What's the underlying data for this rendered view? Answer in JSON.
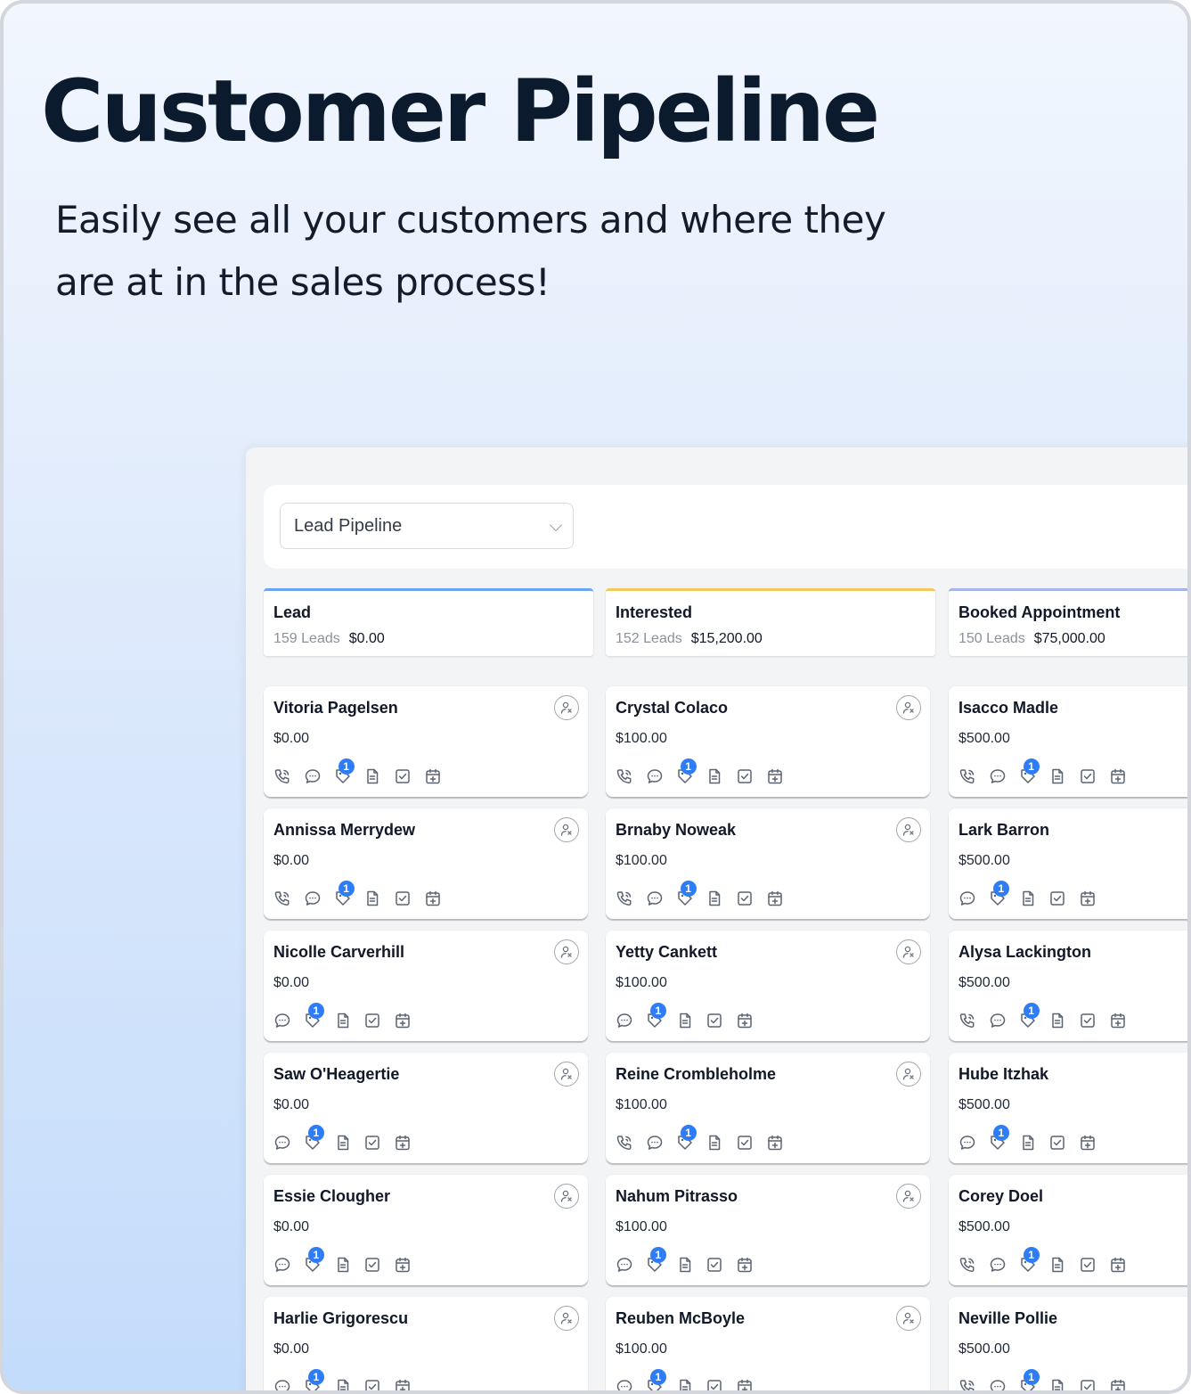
{
  "hero": {
    "title": "Customer Pipeline",
    "subtitle": "Easily see all your customers and where they are at in the sales process!"
  },
  "pipeline_select": {
    "value": "Lead Pipeline"
  },
  "colors": {
    "accent": "#2f7df6",
    "lead": "#6aa5ef",
    "interested": "#f4c85a",
    "booked": "#a9b4e6"
  },
  "stages": [
    {
      "name": "Lead",
      "count": "159 Leads",
      "amount": "$0.00",
      "cards": [
        {
          "name": "Vitoria Pagelsen",
          "value": "$0.00",
          "icons": [
            "phone",
            "chat",
            "tag",
            "doc",
            "check",
            "calendar"
          ],
          "badge": "1"
        },
        {
          "name": "Annissa Merrydew",
          "value": "$0.00",
          "icons": [
            "phone",
            "chat",
            "tag",
            "doc",
            "check",
            "calendar"
          ],
          "badge": "1"
        },
        {
          "name": "Nicolle Carverhill",
          "value": "$0.00",
          "icons": [
            "chat",
            "tag",
            "doc",
            "check",
            "calendar"
          ],
          "badge": "1"
        },
        {
          "name": "Saw O'Heagertie",
          "value": "$0.00",
          "icons": [
            "chat",
            "tag",
            "doc",
            "check",
            "calendar"
          ],
          "badge": "1"
        },
        {
          "name": "Essie Clougher",
          "value": "$0.00",
          "icons": [
            "chat",
            "tag",
            "doc",
            "check",
            "calendar"
          ],
          "badge": "1"
        },
        {
          "name": "Harlie Grigorescu",
          "value": "$0.00",
          "icons": [
            "chat",
            "tag",
            "doc",
            "check",
            "calendar"
          ],
          "badge": "1"
        }
      ]
    },
    {
      "name": "Interested",
      "count": "152 Leads",
      "amount": "$15,200.00",
      "cards": [
        {
          "name": "Crystal Colaco",
          "value": "$100.00",
          "icons": [
            "phone",
            "chat",
            "tag",
            "doc",
            "check",
            "calendar"
          ],
          "badge": "1"
        },
        {
          "name": "Brnaby Noweak",
          "value": "$100.00",
          "icons": [
            "phone",
            "chat",
            "tag",
            "doc",
            "check",
            "calendar"
          ],
          "badge": "1"
        },
        {
          "name": "Yetty Cankett",
          "value": "$100.00",
          "icons": [
            "chat",
            "tag",
            "doc",
            "check",
            "calendar"
          ],
          "badge": "1"
        },
        {
          "name": "Reine Crombleholme",
          "value": "$100.00",
          "icons": [
            "phone",
            "chat",
            "tag",
            "doc",
            "check",
            "calendar"
          ],
          "badge": "1"
        },
        {
          "name": "Nahum Pitrasso",
          "value": "$100.00",
          "icons": [
            "chat",
            "tag",
            "doc",
            "check",
            "calendar"
          ],
          "badge": "1"
        },
        {
          "name": "Reuben McBoyle",
          "value": "$100.00",
          "icons": [
            "chat",
            "tag",
            "doc",
            "check",
            "calendar"
          ],
          "badge": "1"
        }
      ]
    },
    {
      "name": "Booked Appointment",
      "count": "150 Leads",
      "amount": "$75,000.00",
      "cards": [
        {
          "name": "Isacco Madle",
          "value": "$500.00",
          "icons": [
            "phone",
            "chat",
            "tag",
            "doc",
            "check",
            "calendar"
          ],
          "badge": "1"
        },
        {
          "name": "Lark Barron",
          "value": "$500.00",
          "icons": [
            "chat",
            "tag",
            "doc",
            "check",
            "calendar"
          ],
          "badge": "1"
        },
        {
          "name": "Alysa Lackington",
          "value": "$500.00",
          "icons": [
            "phone",
            "chat",
            "tag",
            "doc",
            "check",
            "calendar"
          ],
          "badge": "1"
        },
        {
          "name": "Hube Itzhak",
          "value": "$500.00",
          "icons": [
            "chat",
            "tag",
            "doc",
            "check",
            "calendar"
          ],
          "badge": "1"
        },
        {
          "name": "Corey Doel",
          "value": "$500.00",
          "icons": [
            "phone",
            "chat",
            "tag",
            "doc",
            "check",
            "calendar"
          ],
          "badge": "1"
        },
        {
          "name": "Neville Pollie",
          "value": "$500.00",
          "icons": [
            "phone",
            "chat",
            "tag",
            "doc",
            "check",
            "calendar"
          ],
          "badge": "1"
        }
      ]
    }
  ]
}
